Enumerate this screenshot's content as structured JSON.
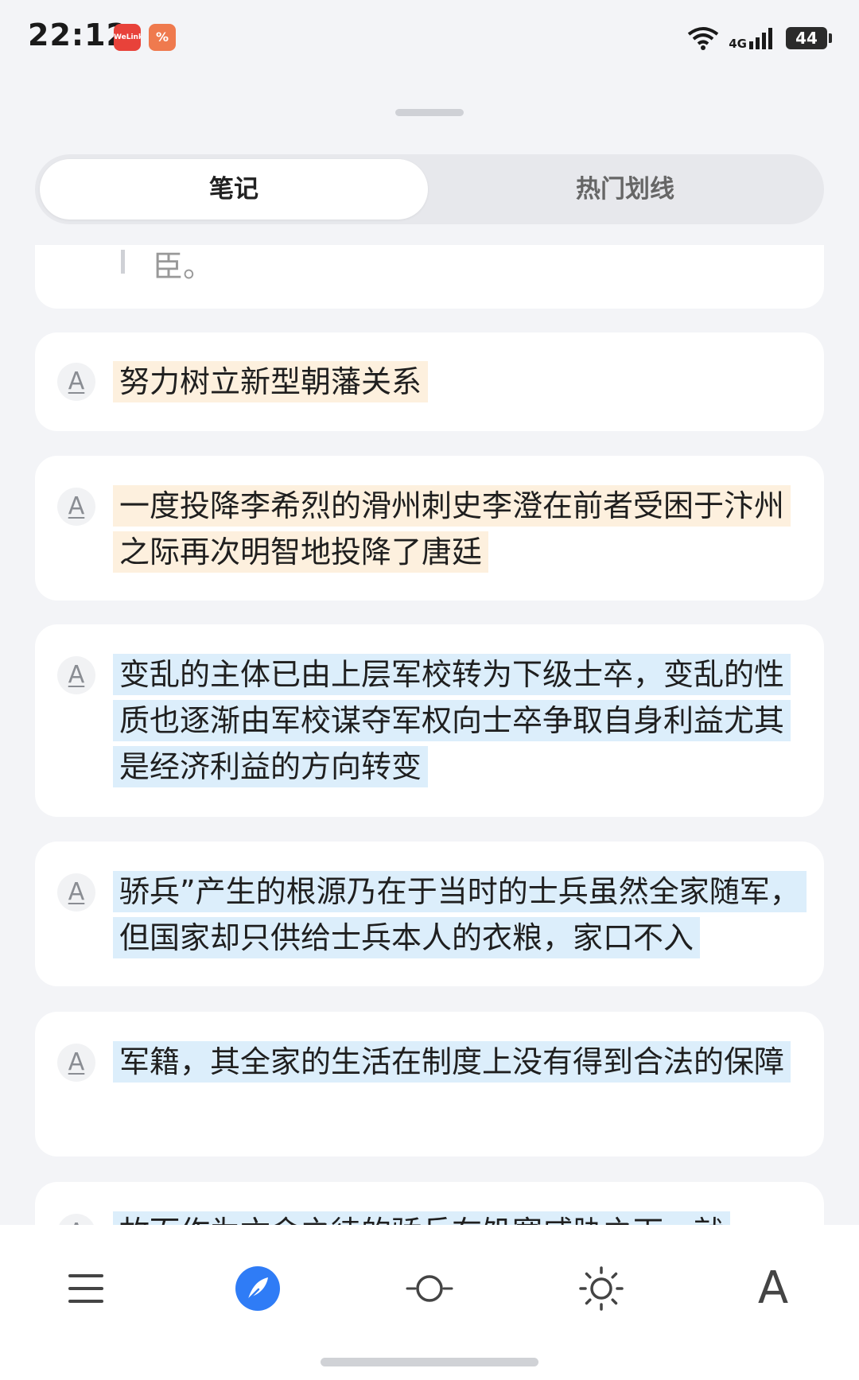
{
  "status_bar": {
    "time": "22:12",
    "app_badges": [
      "WeLink",
      "%"
    ],
    "network": "4G",
    "battery": "44"
  },
  "tabs": [
    {
      "label": "笔记",
      "active": true
    },
    {
      "label": "热门划线",
      "active": false
    }
  ],
  "partial_card_text": "臣。",
  "notes": [
    {
      "icon": "A",
      "text": "努力树立新型朝藩关系",
      "highlight": "orange"
    },
    {
      "icon": "A",
      "text": "一度投降李希烈的滑州刺史李澄在前者受困于汴州之际再次明智地投降了唐廷",
      "highlight": "orange"
    },
    {
      "icon": "A",
      "text": "变乱的主体已由上层军校转为下级士卒，变乱的性质也逐渐由军校谋夺军权向士卒争取自身利益尤其是经济利益的方向转变",
      "highlight": "blue"
    },
    {
      "icon": "A",
      "text": "骄兵”产生的根源乃在于当时的士兵虽然全家随军，但国家却只供给士兵本人的衣粮，家口不入",
      "highlight": "blue"
    },
    {
      "icon": "A",
      "text": "军籍，其全家的生活在制度上没有得到合法的保障",
      "highlight": "blue"
    },
    {
      "icon": "A",
      "text": "故而作为亡命之徒的骄兵在饥寒威胁之下，就",
      "highlight": "blue"
    }
  ],
  "toolbar": {
    "items": [
      "menu-icon",
      "notes-icon",
      "progress-icon",
      "brightness-icon",
      "font-icon"
    ],
    "font_label": "A"
  },
  "colors": {
    "accent": "#2f7cf6",
    "highlight_orange": "#fdf0de",
    "highlight_blue": "#dceefb"
  }
}
